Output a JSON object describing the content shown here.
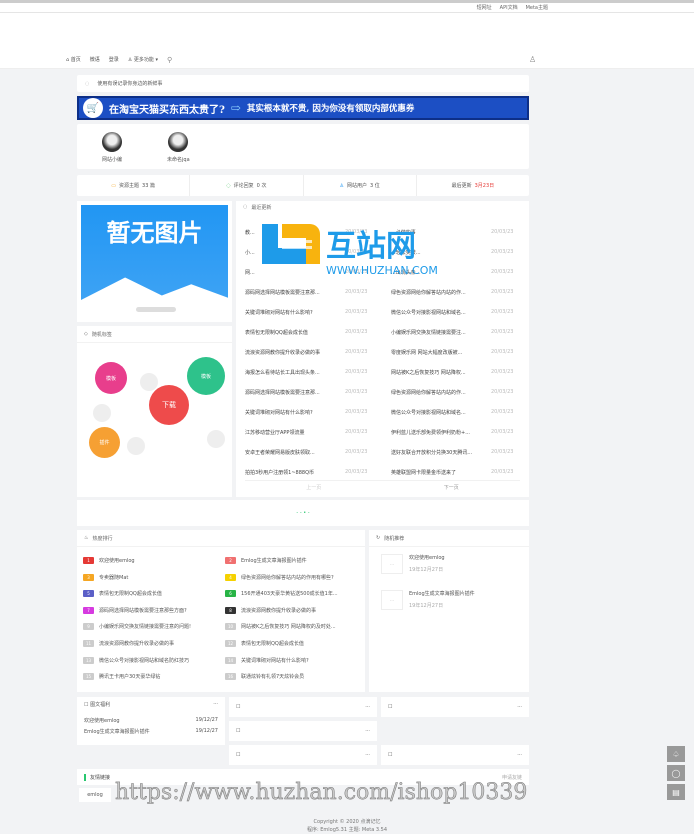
{
  "topbar": {
    "links": [
      "短网址",
      "API文档",
      "Meta主题"
    ]
  },
  "nav": {
    "items": [
      "首页",
      "微语",
      "登录",
      "更多功能"
    ]
  },
  "notice": "使用有误记录你身边的新鲜事",
  "banner": {
    "left": "在淘宝天猫买东西太贵了?",
    "right": "其实根本就不贵, 因为你没有领取内部优惠券"
  },
  "users": [
    {
      "name": "网站小编"
    },
    {
      "name": "未命名jqa"
    }
  ],
  "stats": [
    {
      "label": "资源主题",
      "value": "33 篇"
    },
    {
      "label": "评论回复",
      "value": "0 次"
    },
    {
      "label": "网站用户",
      "value": "3 位"
    },
    {
      "label": "最后更新",
      "value": "3月23日"
    }
  ],
  "no_image": "暂无图片",
  "tags": {
    "title": "随机标签",
    "items": [
      "模板",
      "模板",
      "下载",
      "插件"
    ]
  },
  "news": {
    "title": "最近更新",
    "watermark_logo": "互站网 WWW.HUZHAN.COM",
    "rows": [
      [
        "教...",
        "20/03/23",
        "...必做的事",
        "20/03/23"
      ],
      [
        "小...",
        "20/03/23",
        "...轻松突破...",
        "20/03/23"
      ],
      [
        "网...",
        "20/03/23",
        "...出现头条...",
        "20/03/23"
      ],
      [
        "源码网选择网站模板需要注意那...",
        "20/03/23",
        "绿色资源网给你解答站内站的作...",
        "20/03/23"
      ],
      [
        "关键词堆砌对网站有什么影响?",
        "20/03/23",
        "微信公众号对接影视网站和域名...",
        "20/03/23"
      ],
      [
        "表情包无限制QQ超会成长值",
        "20/03/23",
        "小编娱乐网交换友情链接需要注...",
        "20/03/23"
      ],
      [
        "流浪资源网教你提升收录必做的事",
        "20/03/23",
        "零度娱乐网 网站大幅度改版被...",
        "20/03/23"
      ],
      [
        "海报怎么看待站长工具出现头条...",
        "20/03/23",
        "网站被K之后恢复技巧 网站降权...",
        "20/03/23"
      ],
      [
        "源码网选择网站模板需要注意那...",
        "20/03/23",
        "绿色资源网给你解答站内站的作...",
        "20/03/23"
      ],
      [
        "关键词堆砌对网站有什么影响?",
        "20/03/23",
        "微信公众号对接影视网站和域名...",
        "20/03/23"
      ],
      [
        "江苏移动营业厅APP领流量",
        "20/03/23",
        "伊利蓝儿送乐部免费领伊利奶粉+...",
        "20/03/23"
      ],
      [
        "安卓王者荣耀网易版皮肤领取...",
        "20/03/23",
        "送好友联合开放积分兑换30天腾讯...",
        "20/03/23"
      ],
      [
        "拍拍3秒用户注册领1~888Q币",
        "20/03/23",
        "英雄联盟网卡限量金币送来了",
        "20/03/23"
      ]
    ],
    "prev": "上一页",
    "next": "下一页"
  },
  "loading": "- - • -",
  "hot": {
    "title": "热度排行",
    "items": [
      {
        "n": "1",
        "t": "欢迎使用emlog",
        "c": "#e53935"
      },
      {
        "n": "2",
        "t": "Emlog生成文章海报图片插件",
        "c": "#f07070"
      },
      {
        "n": "3",
        "t": "专卖器随Mat",
        "c": "#f5a623"
      },
      {
        "n": "4",
        "t": "绿色资源网给你解答站内站的作用有哪些?",
        "c": "#f5d100"
      },
      {
        "n": "5",
        "t": "表情包无限制QQ超会成长值",
        "c": "#5b5fc7"
      },
      {
        "n": "6",
        "t": "156开通403天豪华黄钻送500成长值1年...",
        "c": "#28b446"
      },
      {
        "n": "7",
        "t": "源码网选择网站模板需要注意那些方面?",
        "c": "#d63ae0"
      },
      {
        "n": "8",
        "t": "流浪资源网教你提升收录必做的事",
        "c": "#333333"
      },
      {
        "n": "9",
        "t": "小编娱乐网交换友情链接需要注意的问题!",
        "c": "#cccccc"
      },
      {
        "n": "10",
        "t": "网站被K之后恢复技巧 网站降权的及时处...",
        "c": "#cccccc"
      },
      {
        "n": "11",
        "t": "流浪资源网教你提升收录必做的事",
        "c": "#cccccc"
      },
      {
        "n": "12",
        "t": "表情包无限制QQ超会成长值",
        "c": "#cccccc"
      },
      {
        "n": "13",
        "t": "微信公众号对接影视网站和域名防红技巧",
        "c": "#cccccc"
      },
      {
        "n": "14",
        "t": "关键词堆砌对网站有什么影响?",
        "c": "#cccccc"
      },
      {
        "n": "15",
        "t": "腾讯王卡用户30天豪华绿钻",
        "c": "#cccccc"
      },
      {
        "n": "16",
        "t": "联通炫铃有礼领7天炫铃会员",
        "c": "#cccccc"
      }
    ]
  },
  "rec": {
    "title": "随机推荐",
    "items": [
      {
        "t": "欢迎使用emlog",
        "d": "19年12月27日"
      },
      {
        "t": "Emlog生成文章海报图片插件",
        "d": "19年12月27日"
      }
    ]
  },
  "tuwen": {
    "title": "图文福利",
    "more": "···",
    "items": [
      {
        "t": "欢迎使用emlog",
        "d": "19/12/27"
      },
      {
        "t": "Emlog生成文章海报图片插件",
        "d": "19/12/27"
      }
    ]
  },
  "more": "···",
  "links": {
    "title": "友情链接",
    "apply": "申请友链",
    "items": [
      "emlog"
    ]
  },
  "watermark": "https://www.huzhan.com/ishop10339",
  "footer": {
    "copyright": "Copyright © 2020  点滴记忆",
    "program": "程序: Emlog5.31    主题: Meta 3.54"
  }
}
